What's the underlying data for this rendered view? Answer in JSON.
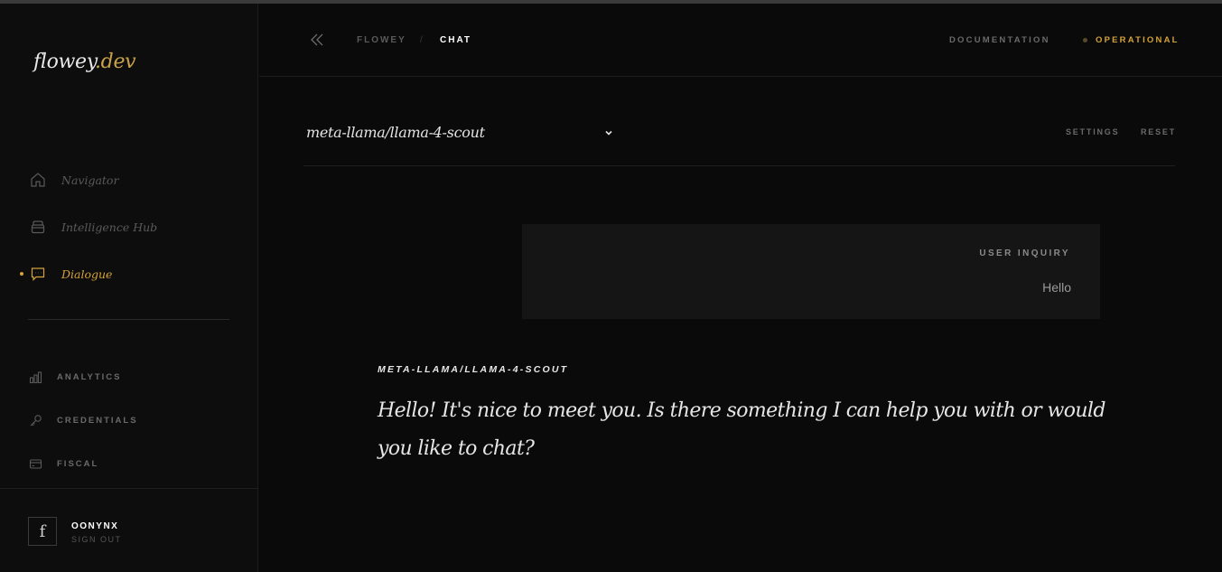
{
  "brand": {
    "name": "flowey",
    "tld": ".dev"
  },
  "sidebar": {
    "primary": [
      {
        "label": "Navigator",
        "icon": "home-icon",
        "active": false
      },
      {
        "label": "Intelligence Hub",
        "icon": "archive-icon",
        "active": false
      },
      {
        "label": "Dialogue",
        "icon": "chat-bubble-icon",
        "active": true
      }
    ],
    "secondary": [
      {
        "label": "ANALYTICS",
        "icon": "bar-chart-icon"
      },
      {
        "label": "CREDENTIALS",
        "icon": "key-icon"
      },
      {
        "label": "FISCAL",
        "icon": "credit-card-icon"
      }
    ],
    "user": {
      "avatar_letter": "f",
      "name": "OONYNX",
      "signout": "SIGN OUT"
    }
  },
  "topbar": {
    "breadcrumb": {
      "root": "FLOWEY",
      "separator": "/",
      "current": "CHAT"
    },
    "documentation": "DOCUMENTATION",
    "status": "OPERATIONAL",
    "status_color": "#d4a23a"
  },
  "chat": {
    "model": "meta-llama/llama-4-scout",
    "settings_label": "SETTINGS",
    "reset_label": "RESET",
    "user_message": {
      "header": "USER INQUIRY",
      "text": "Hello"
    },
    "assistant_message": {
      "model_label": "META-LLAMA/LLAMA-4-SCOUT",
      "text": "Hello! It's nice to meet you. Is there something I can help you with or would you like to chat?"
    }
  },
  "colors": {
    "accent": "#d4a23a",
    "background": "#0a0a0a",
    "sidebar": "#0d0d0d",
    "card": "#151515"
  }
}
